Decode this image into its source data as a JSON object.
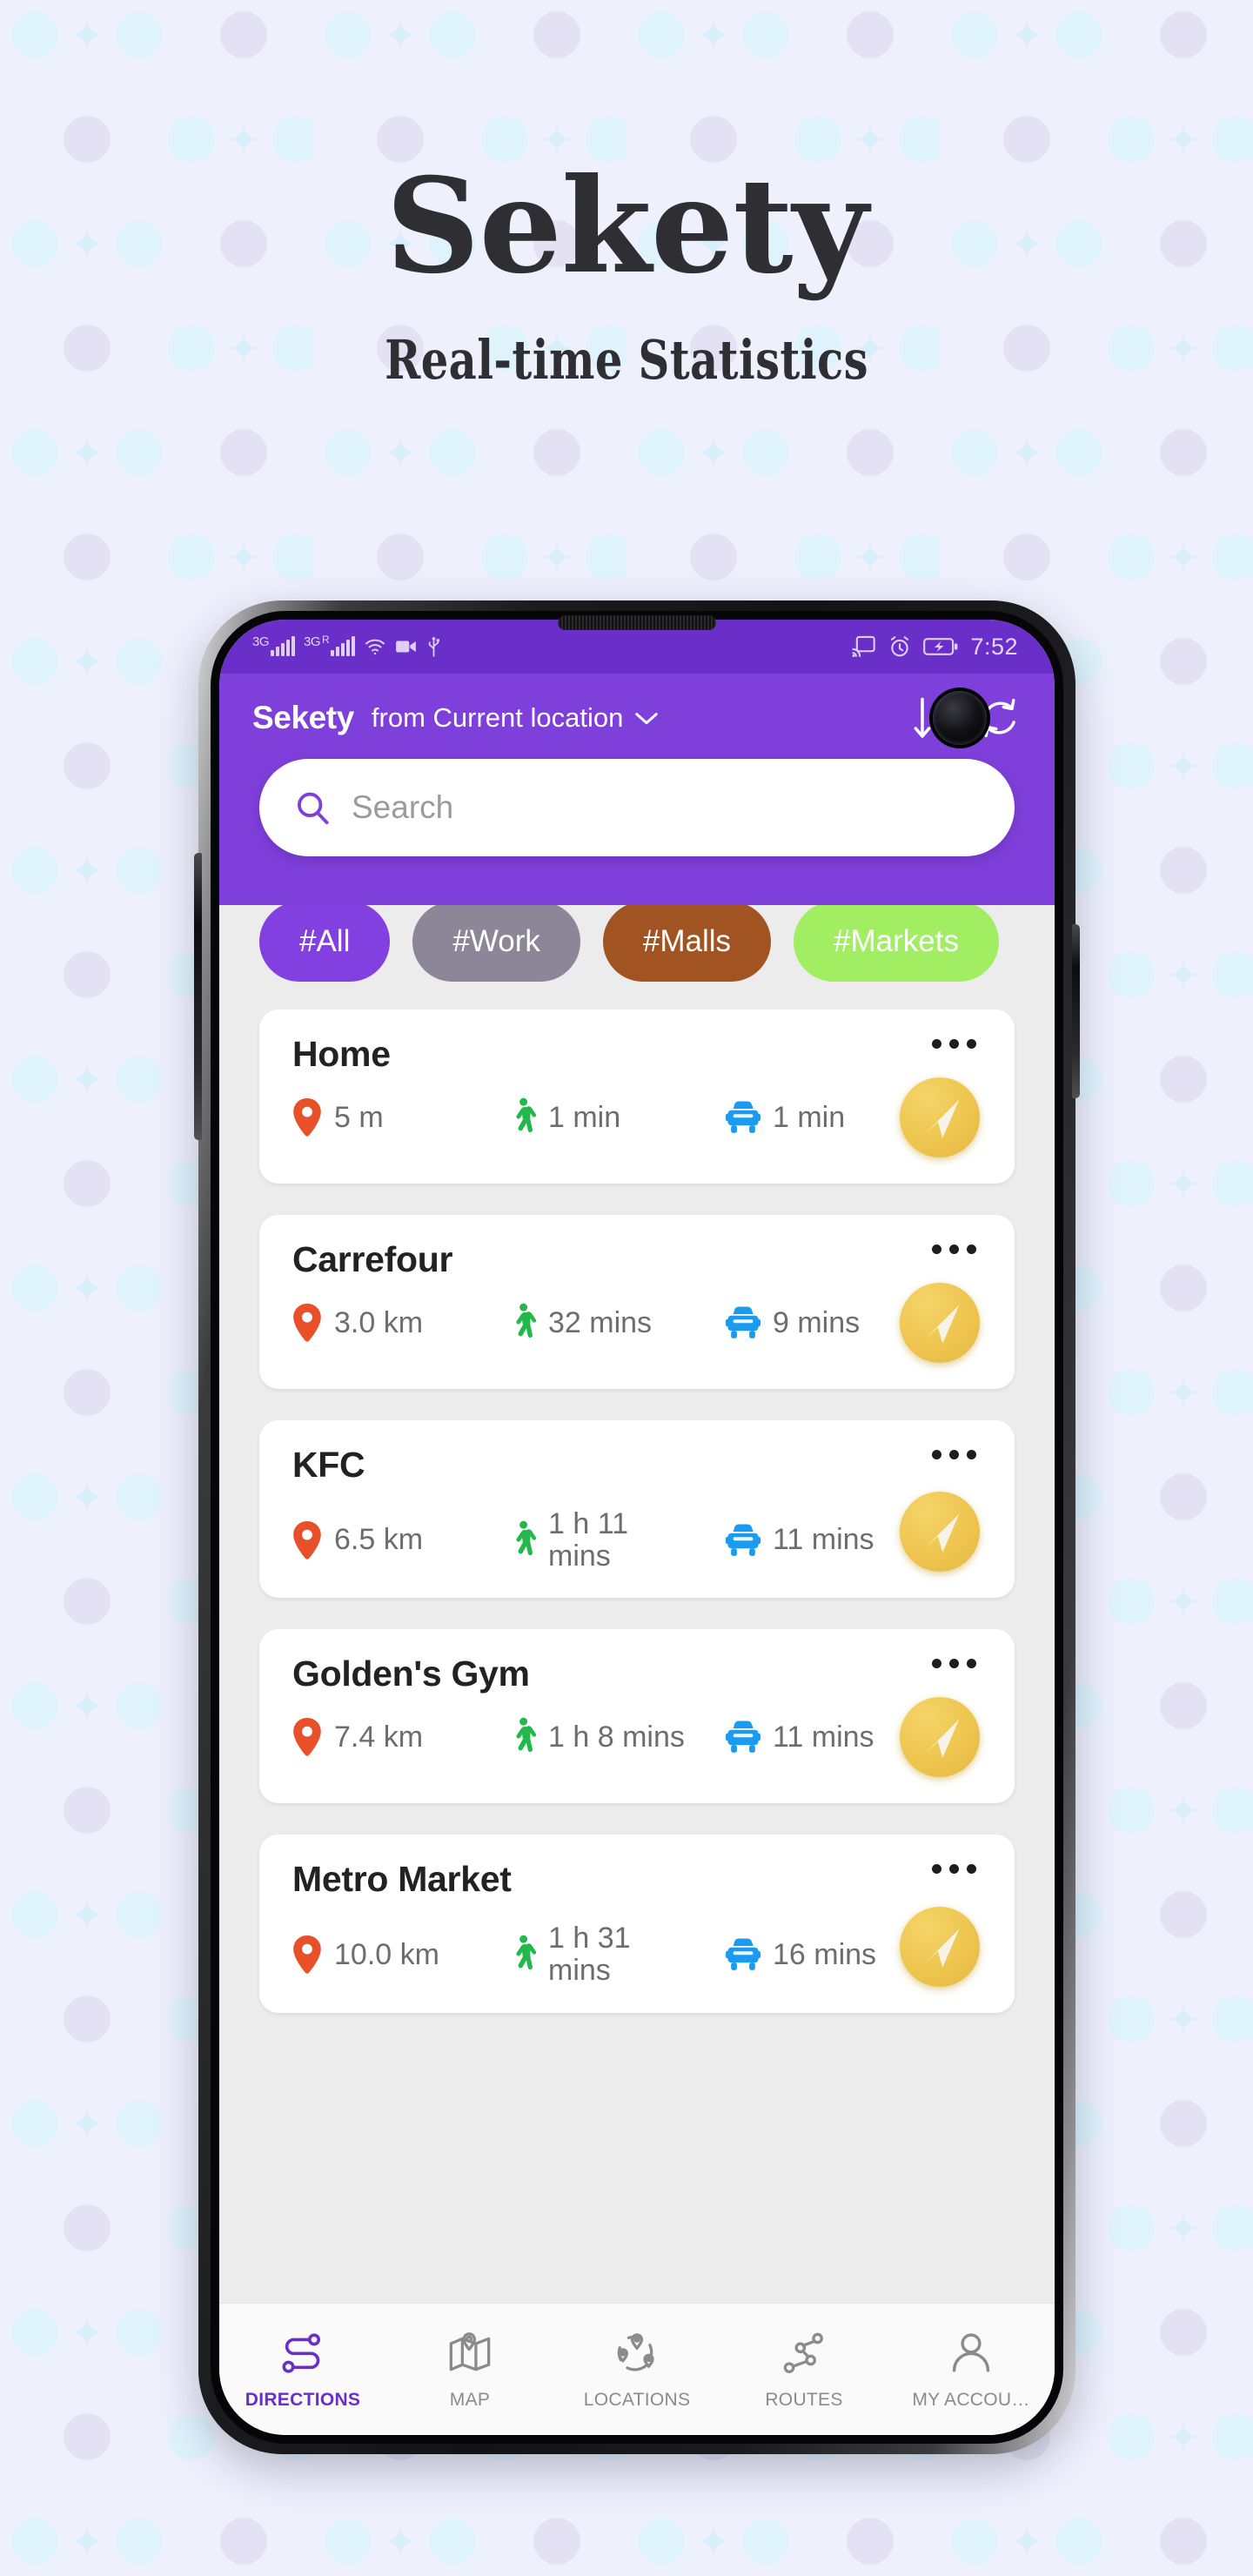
{
  "promo": {
    "title": "Sekety",
    "subtitle": "Real-time Statistics",
    "background_color": "#eef0fc",
    "dot_color_blue": "#dff3fc",
    "dot_color_lavender": "#e3e1f3"
  },
  "status_bar": {
    "network_1_label": "3G",
    "network_2_label": "3G",
    "network_2_sup": "R",
    "icons_left": [
      "signal-3g-icon",
      "signal-3g-roaming-icon",
      "wifi-icon",
      "video-camera-icon",
      "usb-icon"
    ],
    "icons_right": [
      "cast-icon",
      "alarm-icon",
      "battery-charging-icon"
    ],
    "time": "7:52",
    "background_color": "#6b2fc9"
  },
  "app_bar": {
    "title": "Sekety",
    "location_prefix": "from Current location",
    "dropdown_icon": "chevron-down-icon",
    "sort_icon": "sort-arrows-icon",
    "refresh_icon": "refresh-icon",
    "background_color": "#7f3fdb"
  },
  "search": {
    "placeholder": "Search",
    "icon": "search-icon",
    "icon_color": "#7f3fdb"
  },
  "chips": [
    {
      "label": "#All",
      "color": "#8340e0"
    },
    {
      "label": "#Work",
      "color": "#8d8699"
    },
    {
      "label": "#Malls",
      "color": "#a25322"
    },
    {
      "label": "#Markets",
      "color": "#a1ee63"
    }
  ],
  "places": [
    {
      "name": "Home",
      "distance": "5 m",
      "walk_time": "1 min",
      "drive_time": "1 min",
      "walk_time_wraps": false
    },
    {
      "name": "Carrefour",
      "distance": "3.0 km",
      "walk_time": "32 mins",
      "drive_time": "9 mins",
      "walk_time_wraps": false
    },
    {
      "name": "KFC",
      "distance": "6.5 km",
      "walk_time": "1 h 11 mins",
      "drive_time": "11 mins",
      "walk_time_wraps": true
    },
    {
      "name": "Golden's Gym",
      "distance": "7.4 km",
      "walk_time": "1 h 8 mins",
      "drive_time": "11 mins",
      "walk_time_wraps": false
    },
    {
      "name": "Metro Market",
      "distance": "10.0 km",
      "walk_time": "1 h 31 mins",
      "drive_time": "16 mins",
      "walk_time_wraps": true
    }
  ],
  "card_icons": {
    "distance_icon": "map-pin-icon",
    "walk_icon": "walking-person-icon",
    "drive_icon": "car-icon",
    "menu_icon": "more-options-icon",
    "navigate_icon": "navigation-arrow-icon",
    "pin_color": "#e8502a",
    "walk_color": "#23b84b",
    "car_color": "#1a9bf0",
    "fab_color": "#eec54e"
  },
  "bottom_nav": {
    "items": [
      {
        "label": "DIRECTIONS",
        "icon": "directions-route-icon",
        "active": true
      },
      {
        "label": "MAP",
        "icon": "folded-map-icon",
        "active": false
      },
      {
        "label": "LOCATIONS",
        "icon": "locations-circle-icon",
        "active": false
      },
      {
        "label": "ROUTES",
        "icon": "routes-nodes-icon",
        "active": false
      },
      {
        "label": "MY ACCOU…",
        "icon": "user-account-icon",
        "active": false
      }
    ],
    "active_color": "#6b2fc9",
    "inactive_color": "#8b8b8b"
  }
}
